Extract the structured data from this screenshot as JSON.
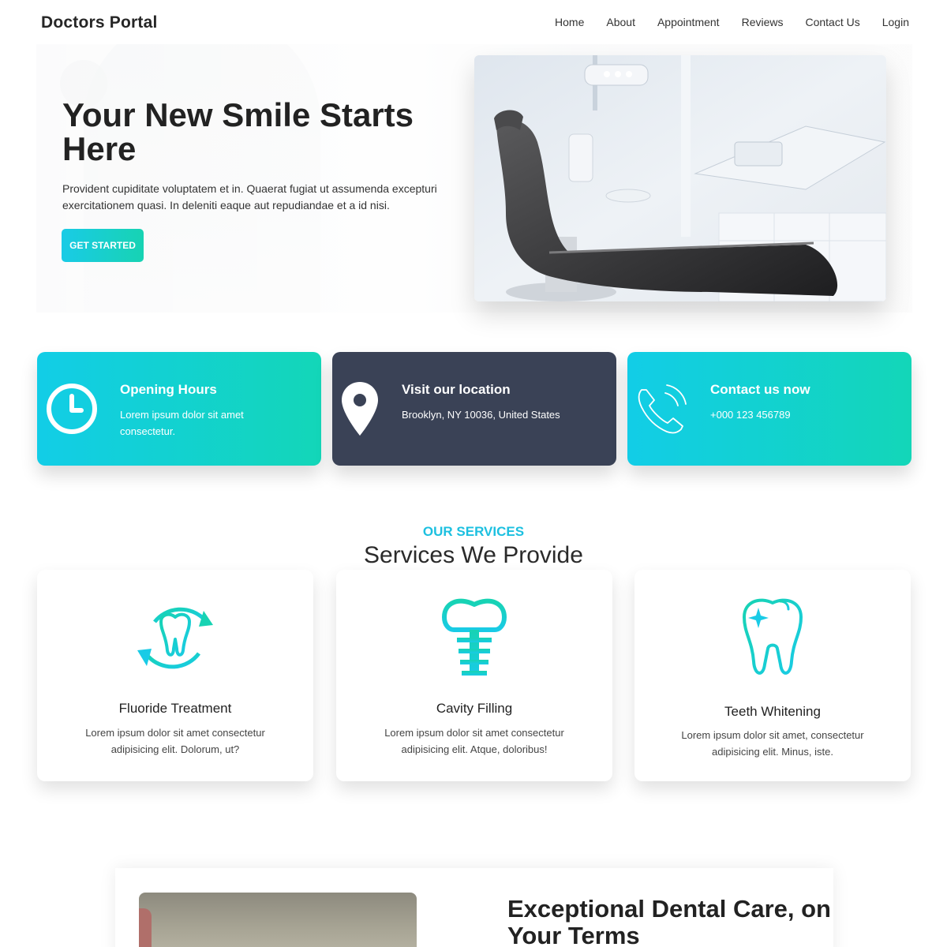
{
  "navbar": {
    "brand": "Doctors Portal",
    "links": [
      "Home",
      "About",
      "Appointment",
      "Reviews",
      "Contact Us",
      "Login"
    ]
  },
  "hero": {
    "title": "Your New Smile Starts Here",
    "text": "Provident cupiditate voluptatem et in. Quaerat fugiat ut assumenda excepturi exercitationem quasi. In deleniti eaque aut repudiandae et a id nisi.",
    "button_label": "GET STARTED"
  },
  "info_cards": [
    {
      "title": "Opening Hours",
      "text": "Lorem ipsum dolor sit amet consectetur.",
      "icon": "clock-icon"
    },
    {
      "title": "Visit our location",
      "text": "Brooklyn, NY 10036, United States",
      "icon": "location-pin-icon"
    },
    {
      "title": "Contact us now",
      "text": "+000 123 456789",
      "icon": "phone-icon"
    }
  ],
  "services": {
    "eyebrow": "OUR SERVICES",
    "heading": "Services We Provide",
    "items": [
      {
        "title": "Fluoride Treatment",
        "text": "Lorem ipsum dolor sit amet consectetur adipisicing elit. Dolorum, ut?",
        "icon": "tooth-cycle-icon"
      },
      {
        "title": "Cavity Filling",
        "text": "Lorem ipsum dolor sit amet consectetur adipisicing elit. Atque, doloribus!",
        "icon": "tooth-implant-icon"
      },
      {
        "title": "Teeth Whitening",
        "text": "Lorem ipsum dolor sit amet, consectetur adipisicing elit. Minus, iste.",
        "icon": "tooth-sparkle-icon"
      }
    ]
  },
  "about": {
    "title": "Exceptional Dental Care, on Your Terms"
  },
  "colors": {
    "accent": "#19cbe6",
    "accent2": "#17d3b3",
    "dark_card": "#3a4256",
    "eyebrow": "#1cc0e0"
  }
}
